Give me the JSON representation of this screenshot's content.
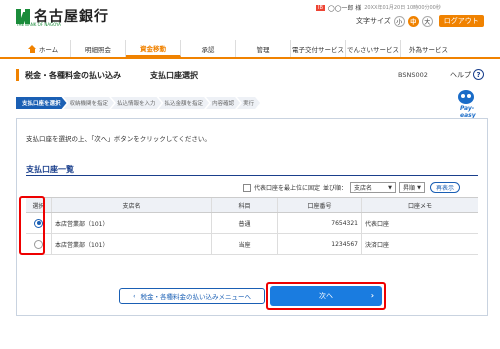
{
  "header": {
    "bank_name": "名古屋銀行",
    "bank_sub": "THE BANK OF NAGOYA",
    "user_badge": "IB",
    "user_name": "◯◯一郎 様",
    "user_datetime": "20XX年01月20日 10時00分00秒",
    "font_size_label": "文字サイズ",
    "font_sizes": [
      "小",
      "中",
      "大"
    ],
    "logout": "ログアウト"
  },
  "nav": {
    "items": [
      "ホーム",
      "明細照会",
      "資金移動",
      "承認",
      "管理",
      "電子交付サービス",
      "でんさいサービス",
      "外為サービス"
    ],
    "active": "資金移動"
  },
  "page": {
    "title": "税金・各種料金の払い込み",
    "subtitle": "支払口座選択",
    "screen_id": "BSNS002",
    "help": "ヘルプ",
    "help_icon": "?"
  },
  "steps": [
    "支払口座を選択",
    "収納機関を指定",
    "払込情報を入力",
    "払込金額を指定",
    "内容確認",
    "実行"
  ],
  "mascot": {
    "text": "Pay-easy"
  },
  "instruction": "支払口座を選択の上、「次へ」ボタンをクリックしてください。",
  "section": {
    "title": "支払口座一覧",
    "checkbox_label": "代表口座を最上位に固定",
    "sort_label": "並び順：",
    "sort_value": "支店名",
    "order_value": "昇順",
    "redisplay": "再表示"
  },
  "table": {
    "headers": [
      "選択",
      "支店名",
      "科目",
      "口座番号",
      "口座メモ"
    ],
    "rows": [
      {
        "branch": "本店営業部（101）",
        "subject": "普通",
        "account": "7654321",
        "memo": "代表口座",
        "selected": true
      },
      {
        "branch": "本店営業部（101）",
        "subject": "当座",
        "account": "1234567",
        "memo": "決済口座",
        "selected": false
      }
    ]
  },
  "buttons": {
    "back": "税金・各種料金の払い込みメニューへ",
    "back_arrow": "‹",
    "next": "次へ",
    "next_arrow": "›"
  },
  "colors": {
    "accent": "#f08200",
    "primary": "#1a5fb4",
    "highlight": "#e00000"
  }
}
